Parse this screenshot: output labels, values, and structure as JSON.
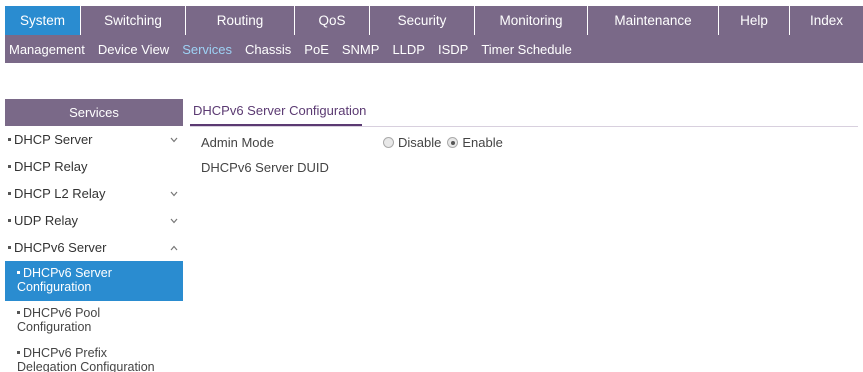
{
  "top_nav": {
    "tabs": [
      {
        "label": "System",
        "active": true
      },
      {
        "label": "Switching",
        "active": false
      },
      {
        "label": "Routing",
        "active": false
      },
      {
        "label": "QoS",
        "active": false
      },
      {
        "label": "Security",
        "active": false
      },
      {
        "label": "Monitoring",
        "active": false
      },
      {
        "label": "Maintenance",
        "active": false
      },
      {
        "label": "Help",
        "active": false
      },
      {
        "label": "Index",
        "active": false
      }
    ]
  },
  "sub_nav": {
    "items": [
      {
        "label": "Management",
        "active": false
      },
      {
        "label": "Device View",
        "active": false
      },
      {
        "label": "Services",
        "active": true
      },
      {
        "label": "Chassis",
        "active": false
      },
      {
        "label": "PoE",
        "active": false
      },
      {
        "label": "SNMP",
        "active": false
      },
      {
        "label": "LLDP",
        "active": false
      },
      {
        "label": "ISDP",
        "active": false
      },
      {
        "label": "Timer Schedule",
        "active": false
      }
    ]
  },
  "sidebar": {
    "header": "Services",
    "items": [
      {
        "label": "DHCP Server",
        "chevron": "chevron-down-icon"
      },
      {
        "label": "DHCP Relay",
        "chevron": ""
      },
      {
        "label": "DHCP L2 Relay",
        "chevron": "chevron-down-icon"
      },
      {
        "label": "UDP Relay",
        "chevron": "chevron-down-icon"
      },
      {
        "label": "DHCPv6 Server",
        "chevron": "chevron-up-icon"
      }
    ],
    "sub_items": [
      {
        "line1": "DHCPv6 Server",
        "line2": "Configuration",
        "active": true
      },
      {
        "line1": "DHCPv6 Pool",
        "line2": "Configuration",
        "active": false
      },
      {
        "line1": "DHCPv6 Prefix",
        "line2": "Delegation Configuration",
        "active": false
      }
    ]
  },
  "main": {
    "title": "DHCPv6 Server Configuration",
    "admin_mode": {
      "label": "Admin Mode",
      "options": [
        "Disable",
        "Enable"
      ],
      "selected": "Enable"
    },
    "duid": {
      "label": "DHCPv6 Server DUID",
      "value": ""
    }
  },
  "colors": {
    "nav_bg": "#7a6988",
    "active_blue": "#2a8cd0",
    "title_purple": "#5b3a72"
  }
}
